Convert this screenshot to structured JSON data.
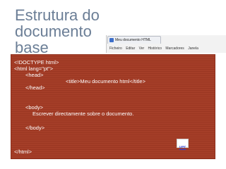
{
  "slide": {
    "title_line1": "Estrutura do documento",
    "title_line2": "base"
  },
  "browser": {
    "tab_title": "Meu documento HTML",
    "tab_icon": "page-icon",
    "menu": [
      "Ficheiro",
      "Editar",
      "Ver",
      "Histórico",
      "Marcadores",
      "Janela"
    ]
  },
  "code": {
    "lines": [
      "<!DOCTYPE html>",
      "<html lang=\"pt\">",
      "<head>",
      "<title>Meu documento html</title>",
      "</head>",
      "<body>",
      "Escrever directamente sobre o documento.",
      "</body>",
      "</html>"
    ]
  },
  "link": {
    "label": "ver"
  },
  "colors": {
    "title": "#6b7e96",
    "code_background": "#a33a24",
    "code_text": "#ffffff",
    "link": "#2b3bd4"
  }
}
